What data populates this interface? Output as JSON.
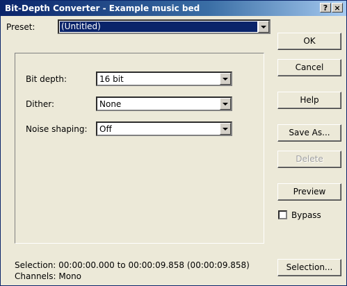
{
  "window": {
    "title": "Bit-Depth Converter - Example music bed",
    "help_glyph": "?",
    "close_glyph": "×"
  },
  "preset": {
    "label": "Preset:",
    "value": "(Untitled)"
  },
  "settings": {
    "bit_depth_label": "Bit depth:",
    "bit_depth_value": "16 bit",
    "dither_label": "Dither:",
    "dither_value": "None",
    "noise_shaping_label": "Noise shaping:",
    "noise_shaping_value": "Off"
  },
  "buttons": {
    "ok": "OK",
    "cancel": "Cancel",
    "help": "Help",
    "save_as": "Save As...",
    "delete": "Delete",
    "preview": "Preview",
    "selection": "Selection..."
  },
  "bypass": {
    "label": "Bypass",
    "checked": false
  },
  "status": {
    "selection": "Selection:  00:00:00.000 to 00:00:09.858 (00:00:09.858)",
    "channels": "Channels:  Mono"
  },
  "colors": {
    "title_bar": "#0a246a",
    "highlight": "#0a246a",
    "face": "#ece9d8"
  }
}
